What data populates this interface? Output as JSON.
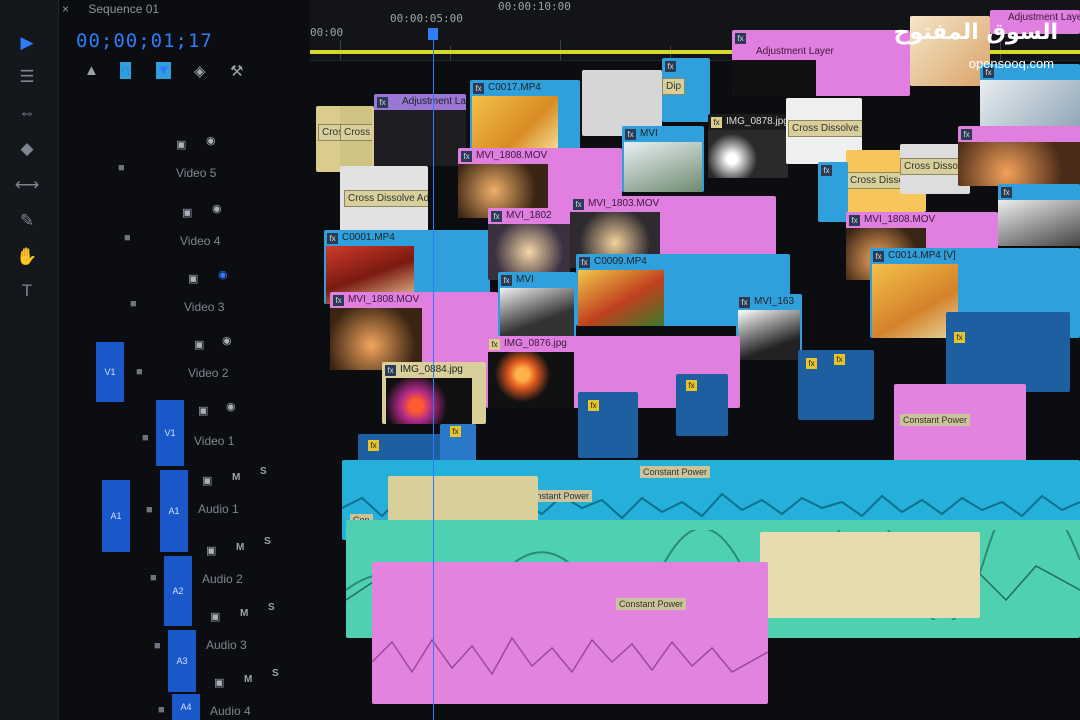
{
  "sequence": {
    "tab_label": "Sequence 01",
    "close_glyph": "×",
    "timecode": "00;00;01;17"
  },
  "ruler": {
    "labels": [
      "00:00",
      "00:00:05:00",
      "00:00:10:00"
    ]
  },
  "colors": {
    "accent": "#2f7cf6",
    "video_pink": "#e07fe0",
    "video_blue": "#2fa0dc",
    "audio_green": "#4fd0b0",
    "audio_pink": "#e07fe0",
    "workarea": "#d8d72b"
  },
  "tracks": {
    "video": [
      "Video 5",
      "Video 4",
      "Video 3",
      "Video 2",
      "Video 1"
    ],
    "video_targets": [
      "V1",
      "V1"
    ],
    "audio": [
      "Audio 1",
      "Audio 2",
      "Audio 3",
      "Audio 4"
    ],
    "audio_targets": [
      "A1",
      "A1",
      "A2",
      "A3",
      "A4"
    ],
    "mute_label": "M",
    "solo_label": "S"
  },
  "clips": {
    "adj1": "Adjustment Lay",
    "adj2": "Adjustment Layer",
    "adj3": "Adjustment Layer",
    "c0017": "C0017.MP4",
    "mvi_1808": "MVI_1808.MOV",
    "mvi_1808b": "MVI_1808.MOV",
    "mvi_1808c": "MVI_1808.MOV",
    "mvi_a": "MVI",
    "mvi_b": "MVI",
    "mvi_1802": "MVI_1802",
    "mvi_1803": "MVI_1803.MOV",
    "mvi_163": "MVI_163",
    "c0001": "C0001.MP4",
    "c0009": "C0009.MP4",
    "c0014": "C0014.MP4 [V]",
    "img_0878": "IMG_0878.jpg",
    "img_0884": "IMG_0884.jpg",
    "img_0876": "IMG_0876.jpg",
    "dip": "Dip",
    "cross": "Cross",
    "cross_d": "Cross D",
    "cross_dissolve": "Cross Dissolve",
    "cross_dissolve_add": "Cross Dissolve  Add",
    "cross_dissolve_b": "Cross Dissolve",
    "cross_dissolve_c": "Cross Dissolve",
    "constant_power": "Constant Power",
    "constant_power_b": "Constant Power",
    "constant_power_c": "Constant Power",
    "constant_power_d": "Constant Power",
    "con": "Con"
  },
  "fx_badge": "fx",
  "logo": {
    "arabic": "السوق المفتوح",
    "latin": "opensooq.com"
  }
}
